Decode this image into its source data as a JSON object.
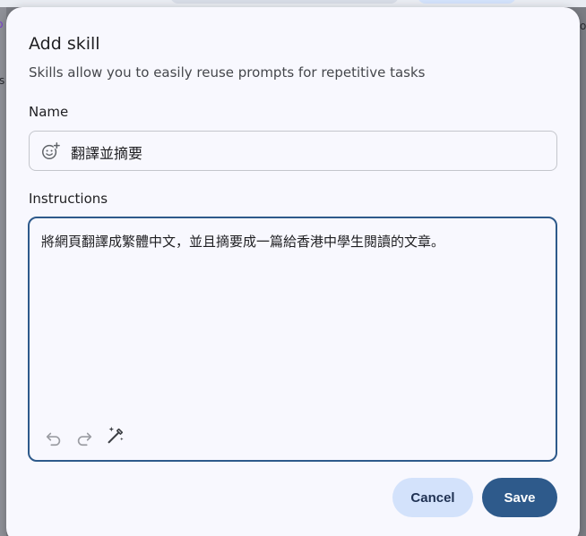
{
  "dialog": {
    "title": "Add skill",
    "subtitle": "Skills allow you to easily reuse prompts for repetitive tasks",
    "name_label": "Name",
    "name_value": "翻譯並摘要",
    "instructions_label": "Instructions",
    "instructions_value": "將網頁翻譯成繁體中文，並且摘要成一篇給香港中學生閱讀的文章。",
    "cancel_label": "Cancel",
    "save_label": "Save"
  },
  "background": {
    "fragment_left_top": "ɔ",
    "fragment_left_mid": "s",
    "fragment_right_top": "o"
  },
  "colors": {
    "accent": "#2e5a8b",
    "cancel_bg": "#d3e2fb",
    "dialog_bg": "#f8f8fe"
  },
  "icons": {
    "name_field": "emoji-add-icon",
    "undo": "undo-icon",
    "redo": "redo-icon",
    "wand": "magic-wand-icon"
  }
}
